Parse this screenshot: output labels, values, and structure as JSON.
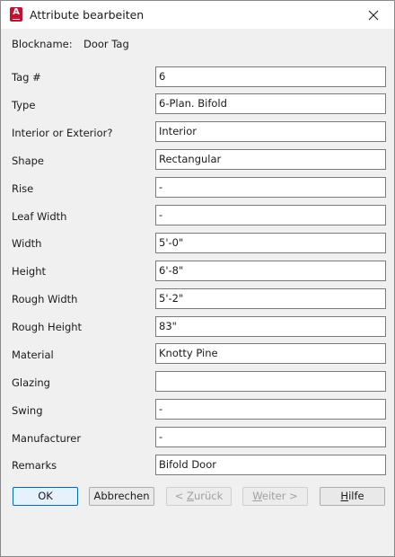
{
  "window": {
    "title": "Attribute bearbeiten",
    "app_icon_letter": "A"
  },
  "block": {
    "label": "Blockname:",
    "value": "Door Tag"
  },
  "attributes": [
    {
      "label": "Tag #",
      "value": "6"
    },
    {
      "label": "Type",
      "value": "6-Plan. Bifold"
    },
    {
      "label": "Interior or Exterior?",
      "value": "Interior"
    },
    {
      "label": "Shape",
      "value": "Rectangular"
    },
    {
      "label": "Rise",
      "value": "-"
    },
    {
      "label": "Leaf Width",
      "value": "-"
    },
    {
      "label": "Width",
      "value": "5'-0\""
    },
    {
      "label": "Height",
      "value": "6'-8\""
    },
    {
      "label": "Rough Width",
      "value": "5'-2\""
    },
    {
      "label": "Rough Height",
      "value": "83\""
    },
    {
      "label": "Material",
      "value": "Knotty Pine"
    },
    {
      "label": "Glazing",
      "value": ""
    },
    {
      "label": "Swing",
      "value": "-"
    },
    {
      "label": "Manufacturer",
      "value": "-"
    },
    {
      "label": "Remarks",
      "value": "Bifold Door"
    }
  ],
  "buttons": {
    "ok": "OK",
    "cancel": "Abbrechen",
    "back": {
      "prefix": "< ",
      "mnemonic": "Z",
      "rest": "urück"
    },
    "next": {
      "mnemonic": "W",
      "rest": "eiter >"
    },
    "help": {
      "mnemonic": "H",
      "rest": "ilfe"
    }
  },
  "colors": {
    "icon_red": "#c8102e",
    "default_button_border": "#0067c0"
  }
}
